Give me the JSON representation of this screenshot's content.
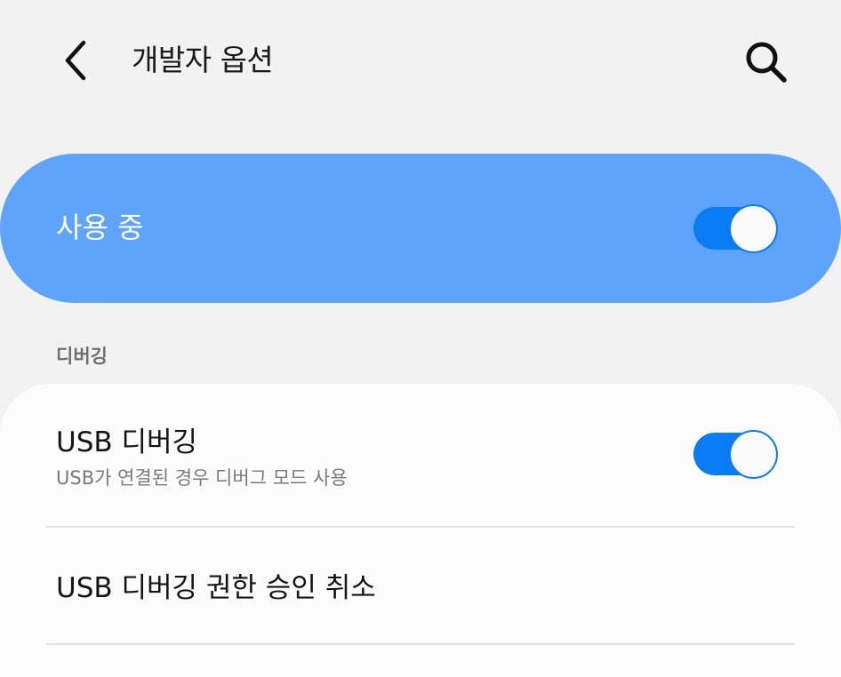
{
  "header": {
    "title": "개발자 옵션",
    "back_icon": "chevron-left-icon",
    "search_icon": "search-icon"
  },
  "master_switch": {
    "label": "사용 중",
    "enabled": true
  },
  "sections": [
    {
      "header": "디버깅",
      "items": [
        {
          "title": "USB 디버깅",
          "subtitle": "USB가 연결된 경우 디버그 모드 사용",
          "toggle": true
        },
        {
          "title": "USB 디버깅 권한 승인 취소"
        }
      ]
    }
  ],
  "colors": {
    "background": "#f2f2f2",
    "master_card": "#5ea4fc",
    "toggle_on": "#0a7cf5",
    "card": "#fcfcfc"
  }
}
